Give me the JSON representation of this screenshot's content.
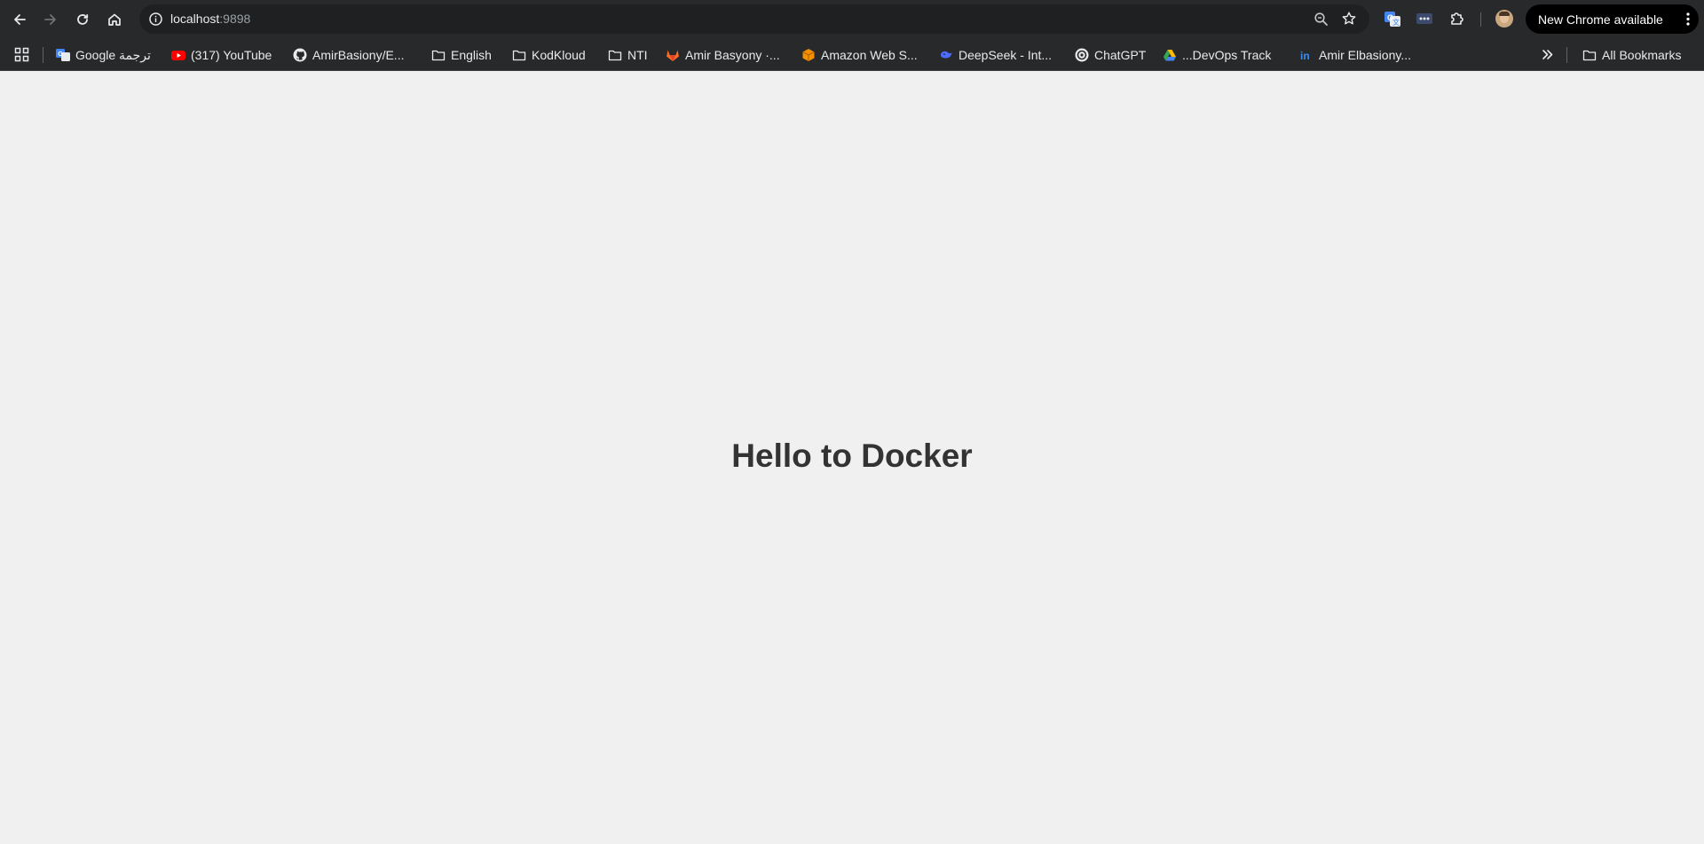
{
  "browser": {
    "url": {
      "host": "localhost",
      "port": ":9898"
    },
    "update_chip_label": "New Chrome available",
    "icons": {
      "back": "back-arrow-icon",
      "forward": "forward-arrow-icon",
      "reload": "reload-icon",
      "home": "home-icon",
      "site_info": "site-info-icon",
      "zoom": "zoom-icon",
      "bookmark_star": "star-icon",
      "extension_translate": "translate-extension-icon",
      "extension_other": "extension-dots-icon",
      "extensions_menu": "puzzle-icon",
      "menu": "kebab-menu-icon"
    },
    "colors": {
      "toolbar": "#28292b",
      "omnibox": "#1f2022",
      "page_bg": "#f0f0f0",
      "heading": "#333333"
    }
  },
  "bookmarks": {
    "items": [
      {
        "label": "Google ترجمة",
        "icon": "google-translate-icon"
      },
      {
        "label": "(317) YouTube",
        "icon": "youtube-icon"
      },
      {
        "label": "AmirBasiony/E...",
        "icon": "github-icon"
      },
      {
        "label": "English",
        "icon": "folder-icon"
      },
      {
        "label": "KodKloud",
        "icon": "folder-icon"
      },
      {
        "label": "NTI",
        "icon": "folder-icon"
      },
      {
        "label": "Amir Basyony ·...",
        "icon": "gitlab-icon"
      },
      {
        "label": "Amazon Web S...",
        "icon": "aws-cube-icon"
      },
      {
        "label": "DeepSeek - Int...",
        "icon": "deepseek-icon"
      },
      {
        "label": "ChatGPT",
        "icon": "chatgpt-icon"
      },
      {
        "label": "...DevOps Track",
        "icon": "google-drive-icon"
      },
      {
        "label": "Amir Elbasiony...",
        "icon": "linkedin-icon"
      }
    ],
    "all_bookmarks_label": "All Bookmarks"
  },
  "page": {
    "heading": "Hello to Docker"
  }
}
